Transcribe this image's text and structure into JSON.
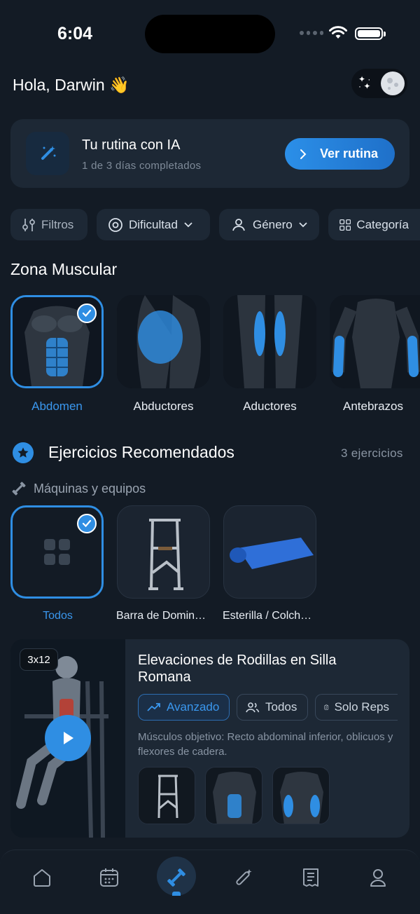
{
  "status_bar": {
    "time": "6:04"
  },
  "header": {
    "greeting": "Hola, Darwin 👋"
  },
  "routine_card": {
    "title": "Tu rutina con IA",
    "subtitle": "1 de 3 días completados",
    "button_label": "Ver rutina"
  },
  "filters": [
    {
      "label": "Filtros",
      "icon": "sliders-icon"
    },
    {
      "label": "Dificultad",
      "icon": "gauge-icon"
    },
    {
      "label": "Género",
      "icon": "users-icon"
    },
    {
      "label": "Categoría",
      "icon": "grid-icon"
    }
  ],
  "muscle_zone": {
    "title": "Zona Muscular",
    "items": [
      {
        "label": "Abdomen",
        "selected": true
      },
      {
        "label": "Abductores",
        "selected": false
      },
      {
        "label": "Aductores",
        "selected": false
      },
      {
        "label": "Antebrazos",
        "selected": false
      }
    ]
  },
  "recommended": {
    "title": "Ejercicios Recomendados",
    "count": "3 ejercicios",
    "equipment_title": "Máquinas y equipos",
    "equipment": [
      {
        "label": "Todos",
        "selected": true
      },
      {
        "label": "Barra de Dominadas",
        "selected": false
      },
      {
        "label": "Esterilla / Colchoneta",
        "selected": false
      }
    ]
  },
  "exercise": {
    "sets_badge": "3x12",
    "title": "Elevaciones de Rodillas en Silla Romana",
    "tags": [
      "Avanzado",
      "Todos",
      "Solo Reps"
    ],
    "description": "Músculos objetivo: Recto abdominal inferior, oblicuos y flexores de cadera."
  },
  "nav": {
    "items": [
      "home-icon",
      "calendar-icon",
      "dumbbell-icon",
      "magic-wand-icon",
      "receipt-icon",
      "user-icon"
    ],
    "active_index": 2
  },
  "colors": {
    "accent": "#2f8ee3",
    "background": "#131b25",
    "card": "#1d2835"
  }
}
